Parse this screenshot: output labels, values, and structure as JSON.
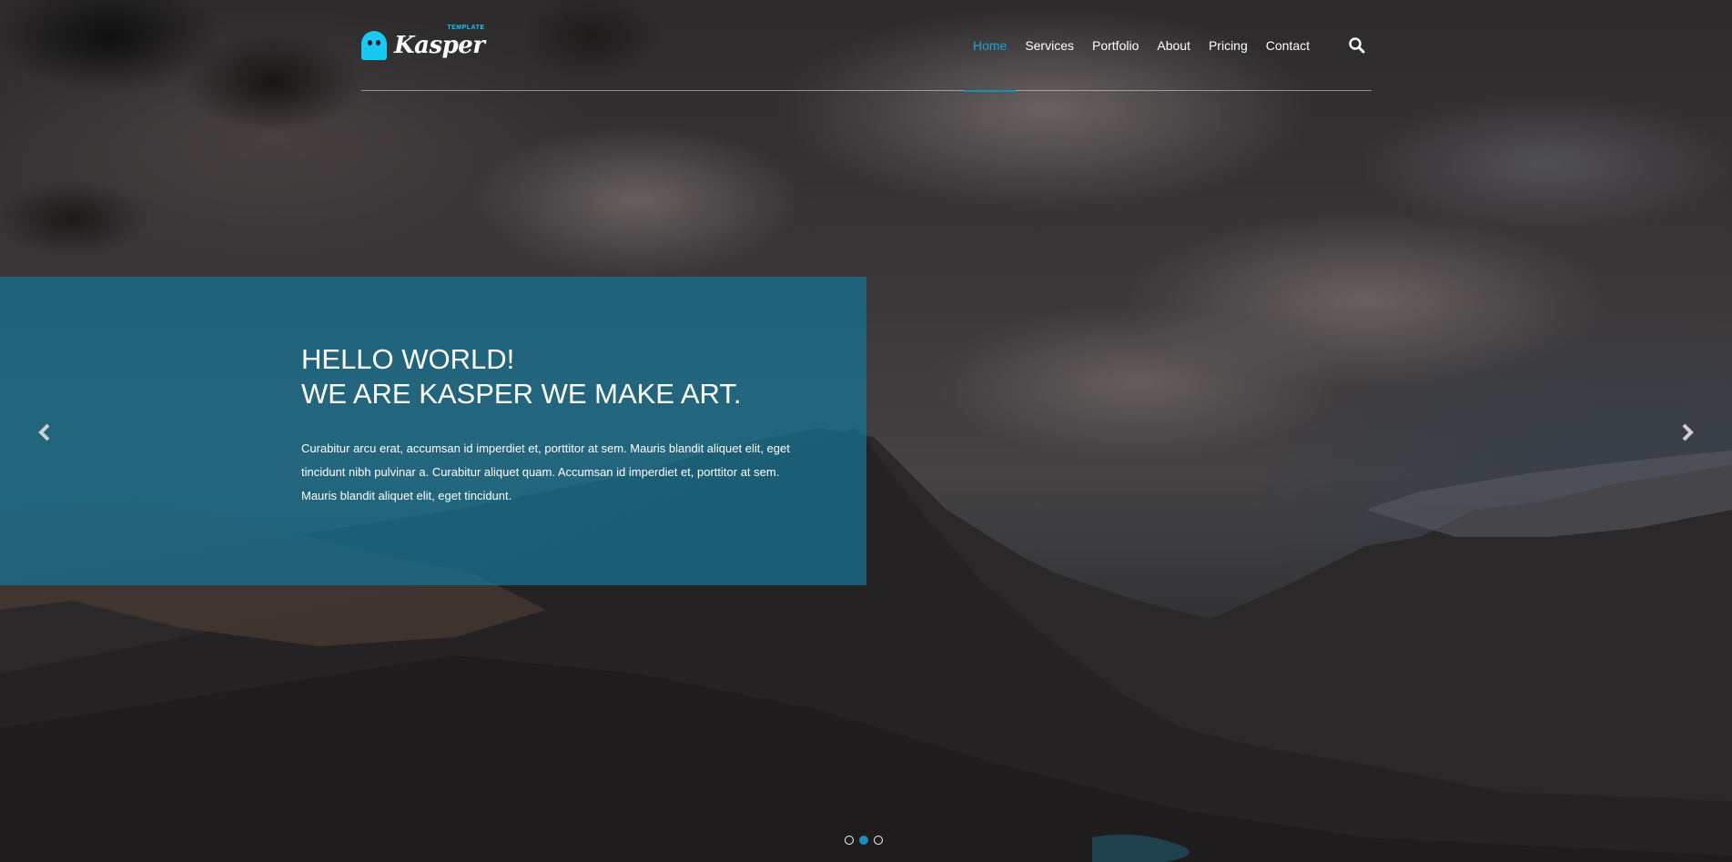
{
  "brand": {
    "name": "Kasper",
    "tag": "TEMPLATE",
    "accent_color": "#1fa2cf"
  },
  "nav": {
    "items": [
      {
        "label": "Home",
        "active": true
      },
      {
        "label": "Services",
        "active": false
      },
      {
        "label": "Portfolio",
        "active": false
      },
      {
        "label": "About",
        "active": false
      },
      {
        "label": "Pricing",
        "active": false
      },
      {
        "label": "Contact",
        "active": false
      }
    ],
    "search_icon": "search-icon"
  },
  "slide": {
    "title_line1": "HELLO WORLD!",
    "title_line2": "WE ARE KASPER WE MAKE ART.",
    "description": "Curabitur arcu erat, accumsan id imperdiet et, porttitor at sem. Mauris blandit aliquet elit, eget tincidunt nibh pulvinar a. Curabitur aliquet quam. Accumsan id imperdiet et, porttitor at sem. Mauris blandit aliquet elit, eget tincidunt.",
    "box_color": "#167594"
  },
  "carousel": {
    "prev_icon": "chevron-left-icon",
    "next_icon": "chevron-right-icon",
    "slides_count": 3,
    "active_index": 1
  }
}
